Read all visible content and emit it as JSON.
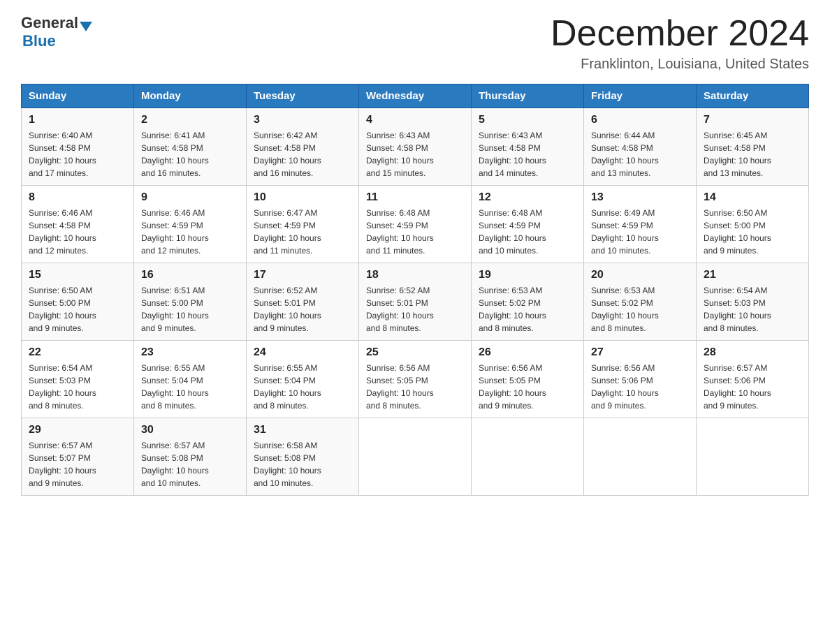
{
  "header": {
    "logo_general": "General",
    "logo_blue": "Blue",
    "month_title": "December 2024",
    "location": "Franklinton, Louisiana, United States"
  },
  "days_of_week": [
    "Sunday",
    "Monday",
    "Tuesday",
    "Wednesday",
    "Thursday",
    "Friday",
    "Saturday"
  ],
  "weeks": [
    [
      {
        "num": "1",
        "sunrise": "6:40 AM",
        "sunset": "4:58 PM",
        "daylight": "10 hours and 17 minutes."
      },
      {
        "num": "2",
        "sunrise": "6:41 AM",
        "sunset": "4:58 PM",
        "daylight": "10 hours and 16 minutes."
      },
      {
        "num": "3",
        "sunrise": "6:42 AM",
        "sunset": "4:58 PM",
        "daylight": "10 hours and 16 minutes."
      },
      {
        "num": "4",
        "sunrise": "6:43 AM",
        "sunset": "4:58 PM",
        "daylight": "10 hours and 15 minutes."
      },
      {
        "num": "5",
        "sunrise": "6:43 AM",
        "sunset": "4:58 PM",
        "daylight": "10 hours and 14 minutes."
      },
      {
        "num": "6",
        "sunrise": "6:44 AM",
        "sunset": "4:58 PM",
        "daylight": "10 hours and 13 minutes."
      },
      {
        "num": "7",
        "sunrise": "6:45 AM",
        "sunset": "4:58 PM",
        "daylight": "10 hours and 13 minutes."
      }
    ],
    [
      {
        "num": "8",
        "sunrise": "6:46 AM",
        "sunset": "4:58 PM",
        "daylight": "10 hours and 12 minutes."
      },
      {
        "num": "9",
        "sunrise": "6:46 AM",
        "sunset": "4:59 PM",
        "daylight": "10 hours and 12 minutes."
      },
      {
        "num": "10",
        "sunrise": "6:47 AM",
        "sunset": "4:59 PM",
        "daylight": "10 hours and 11 minutes."
      },
      {
        "num": "11",
        "sunrise": "6:48 AM",
        "sunset": "4:59 PM",
        "daylight": "10 hours and 11 minutes."
      },
      {
        "num": "12",
        "sunrise": "6:48 AM",
        "sunset": "4:59 PM",
        "daylight": "10 hours and 10 minutes."
      },
      {
        "num": "13",
        "sunrise": "6:49 AM",
        "sunset": "4:59 PM",
        "daylight": "10 hours and 10 minutes."
      },
      {
        "num": "14",
        "sunrise": "6:50 AM",
        "sunset": "5:00 PM",
        "daylight": "10 hours and 9 minutes."
      }
    ],
    [
      {
        "num": "15",
        "sunrise": "6:50 AM",
        "sunset": "5:00 PM",
        "daylight": "10 hours and 9 minutes."
      },
      {
        "num": "16",
        "sunrise": "6:51 AM",
        "sunset": "5:00 PM",
        "daylight": "10 hours and 9 minutes."
      },
      {
        "num": "17",
        "sunrise": "6:52 AM",
        "sunset": "5:01 PM",
        "daylight": "10 hours and 9 minutes."
      },
      {
        "num": "18",
        "sunrise": "6:52 AM",
        "sunset": "5:01 PM",
        "daylight": "10 hours and 8 minutes."
      },
      {
        "num": "19",
        "sunrise": "6:53 AM",
        "sunset": "5:02 PM",
        "daylight": "10 hours and 8 minutes."
      },
      {
        "num": "20",
        "sunrise": "6:53 AM",
        "sunset": "5:02 PM",
        "daylight": "10 hours and 8 minutes."
      },
      {
        "num": "21",
        "sunrise": "6:54 AM",
        "sunset": "5:03 PM",
        "daylight": "10 hours and 8 minutes."
      }
    ],
    [
      {
        "num": "22",
        "sunrise": "6:54 AM",
        "sunset": "5:03 PM",
        "daylight": "10 hours and 8 minutes."
      },
      {
        "num": "23",
        "sunrise": "6:55 AM",
        "sunset": "5:04 PM",
        "daylight": "10 hours and 8 minutes."
      },
      {
        "num": "24",
        "sunrise": "6:55 AM",
        "sunset": "5:04 PM",
        "daylight": "10 hours and 8 minutes."
      },
      {
        "num": "25",
        "sunrise": "6:56 AM",
        "sunset": "5:05 PM",
        "daylight": "10 hours and 8 minutes."
      },
      {
        "num": "26",
        "sunrise": "6:56 AM",
        "sunset": "5:05 PM",
        "daylight": "10 hours and 9 minutes."
      },
      {
        "num": "27",
        "sunrise": "6:56 AM",
        "sunset": "5:06 PM",
        "daylight": "10 hours and 9 minutes."
      },
      {
        "num": "28",
        "sunrise": "6:57 AM",
        "sunset": "5:06 PM",
        "daylight": "10 hours and 9 minutes."
      }
    ],
    [
      {
        "num": "29",
        "sunrise": "6:57 AM",
        "sunset": "5:07 PM",
        "daylight": "10 hours and 9 minutes."
      },
      {
        "num": "30",
        "sunrise": "6:57 AM",
        "sunset": "5:08 PM",
        "daylight": "10 hours and 10 minutes."
      },
      {
        "num": "31",
        "sunrise": "6:58 AM",
        "sunset": "5:08 PM",
        "daylight": "10 hours and 10 minutes."
      },
      null,
      null,
      null,
      null
    ]
  ],
  "labels": {
    "sunrise": "Sunrise:",
    "sunset": "Sunset:",
    "daylight": "Daylight:"
  }
}
